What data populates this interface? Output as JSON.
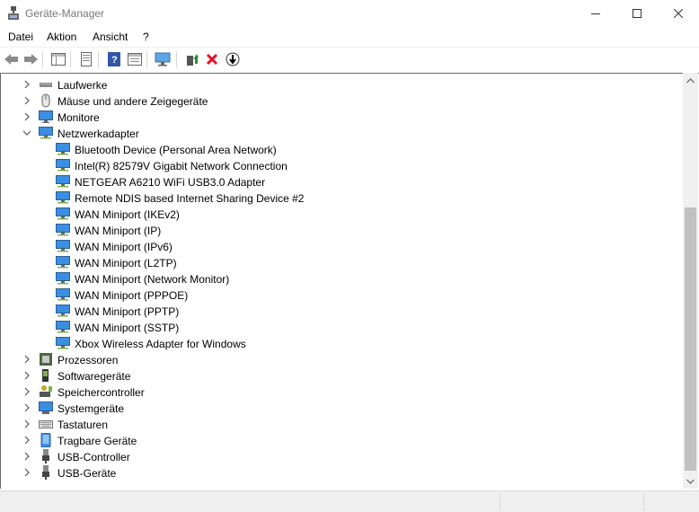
{
  "window": {
    "title": "Geräte-Manager"
  },
  "menu": {
    "datei": "Datei",
    "aktion": "Aktion",
    "ansicht": "Ansicht",
    "help": "?"
  },
  "tree": {
    "laufwerke": "Laufwerke",
    "maeuse": "Mäuse und andere Zeigegeräte",
    "monitore": "Monitore",
    "netzwerkadapter": "Netzwerkadapter",
    "netzwerk_children": [
      "Bluetooth Device (Personal Area Network)",
      "Intel(R) 82579V Gigabit Network Connection",
      "NETGEAR A6210 WiFi USB3.0 Adapter",
      "Remote NDIS based Internet Sharing Device #2",
      "WAN Miniport (IKEv2)",
      "WAN Miniport (IP)",
      "WAN Miniport (IPv6)",
      "WAN Miniport (L2TP)",
      "WAN Miniport (Network Monitor)",
      "WAN Miniport (PPPOE)",
      "WAN Miniport (PPTP)",
      "WAN Miniport (SSTP)",
      "Xbox Wireless Adapter for Windows"
    ],
    "prozessoren": "Prozessoren",
    "softwaregeraete": "Softwaregeräte",
    "speichercontroller": "Speichercontroller",
    "systemgeraete": "Systemgeräte",
    "tastaturen": "Tastaturen",
    "tragbare_geraete": "Tragbare Geräte",
    "usb_controller": "USB-Controller",
    "usb_geraete": "USB-Geräte"
  },
  "colors": {
    "accent": "#3c8ee0",
    "remove": "#e81123",
    "update": "#2e8b3a"
  },
  "icons": [
    "back-icon",
    "forward-icon",
    "properties-icon",
    "show-hide-icon",
    "help-icon",
    "view-icon",
    "scan-icon",
    "update-driver-icon",
    "uninstall-icon",
    "disable-icon"
  ]
}
